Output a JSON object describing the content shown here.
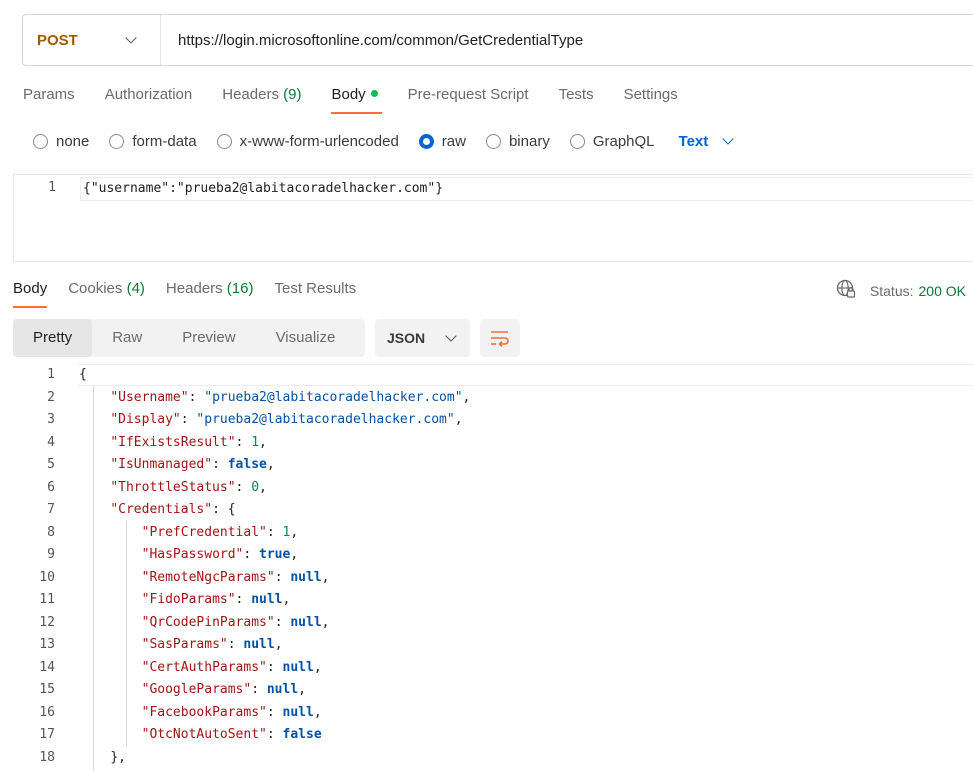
{
  "request": {
    "method": "POST",
    "url": "https://login.microsoftonline.com/common/GetCredentialType"
  },
  "request_tabs": [
    {
      "label": "Params",
      "count": ""
    },
    {
      "label": "Authorization",
      "count": ""
    },
    {
      "label": "Headers",
      "count": "(9)"
    },
    {
      "label": "Body",
      "count": ""
    },
    {
      "label": "Pre-request Script",
      "count": ""
    },
    {
      "label": "Tests",
      "count": ""
    },
    {
      "label": "Settings",
      "count": ""
    }
  ],
  "active_request_tab": "Body",
  "body_types": [
    "none",
    "form-data",
    "x-www-form-urlencoded",
    "raw",
    "binary",
    "GraphQL"
  ],
  "selected_body_type": "raw",
  "raw_format": "Text",
  "request_body": {
    "line_number": "1",
    "text": "{\"username\":\"prueba2@labitacoradelhacker.com\"}"
  },
  "response_tabs": [
    {
      "label": "Body",
      "count": ""
    },
    {
      "label": "Cookies",
      "count": "(4)"
    },
    {
      "label": "Headers",
      "count": "(16)"
    },
    {
      "label": "Test Results",
      "count": ""
    }
  ],
  "status": {
    "label": "Status:",
    "value": "200 OK"
  },
  "view_modes": [
    "Pretty",
    "Raw",
    "Preview",
    "Visualize"
  ],
  "active_view_mode": "Pretty",
  "response_format": "JSON",
  "icons": {
    "method_dropdown": "chevron-down-icon",
    "format_dropdown": "chevron-down-icon",
    "network": "globe-icon",
    "wrap": "wrap-lines-icon"
  },
  "colors": {
    "accent": "#ff6c37",
    "method": "#a35a00",
    "link": "#0265d2",
    "success": "#0a7a34"
  },
  "response_lines": [
    {
      "n": "1",
      "indent": 0,
      "tokens": [
        [
          "p",
          "{"
        ]
      ]
    },
    {
      "n": "2",
      "indent": 1,
      "tokens": [
        [
          "k",
          "\"Username\""
        ],
        [
          "p",
          ": "
        ],
        [
          "s",
          "\"prueba2@labitacoradelhacker.com\""
        ],
        [
          "p",
          ","
        ]
      ]
    },
    {
      "n": "3",
      "indent": 1,
      "tokens": [
        [
          "k",
          "\"Display\""
        ],
        [
          "p",
          ": "
        ],
        [
          "s",
          "\"prueba2@labitacoradelhacker.com\""
        ],
        [
          "p",
          ","
        ]
      ]
    },
    {
      "n": "4",
      "indent": 1,
      "tokens": [
        [
          "k",
          "\"IfExistsResult\""
        ],
        [
          "p",
          ": "
        ],
        [
          "num",
          "1"
        ],
        [
          "p",
          ","
        ]
      ]
    },
    {
      "n": "5",
      "indent": 1,
      "tokens": [
        [
          "k",
          "\"IsUnmanaged\""
        ],
        [
          "p",
          ": "
        ],
        [
          "b",
          "false"
        ],
        [
          "p",
          ","
        ]
      ]
    },
    {
      "n": "6",
      "indent": 1,
      "tokens": [
        [
          "k",
          "\"ThrottleStatus\""
        ],
        [
          "p",
          ": "
        ],
        [
          "num",
          "0"
        ],
        [
          "p",
          ","
        ]
      ]
    },
    {
      "n": "7",
      "indent": 1,
      "tokens": [
        [
          "k",
          "\"Credentials\""
        ],
        [
          "p",
          ": {"
        ]
      ]
    },
    {
      "n": "8",
      "indent": 2,
      "tokens": [
        [
          "k",
          "\"PrefCredential\""
        ],
        [
          "p",
          ": "
        ],
        [
          "num",
          "1"
        ],
        [
          "p",
          ","
        ]
      ]
    },
    {
      "n": "9",
      "indent": 2,
      "tokens": [
        [
          "k",
          "\"HasPassword\""
        ],
        [
          "p",
          ": "
        ],
        [
          "b",
          "true"
        ],
        [
          "p",
          ","
        ]
      ]
    },
    {
      "n": "10",
      "indent": 2,
      "tokens": [
        [
          "k",
          "\"RemoteNgcParams\""
        ],
        [
          "p",
          ": "
        ],
        [
          "b",
          "null"
        ],
        [
          "p",
          ","
        ]
      ]
    },
    {
      "n": "11",
      "indent": 2,
      "tokens": [
        [
          "k",
          "\"FidoParams\""
        ],
        [
          "p",
          ": "
        ],
        [
          "b",
          "null"
        ],
        [
          "p",
          ","
        ]
      ]
    },
    {
      "n": "12",
      "indent": 2,
      "tokens": [
        [
          "k",
          "\"QrCodePinParams\""
        ],
        [
          "p",
          ": "
        ],
        [
          "b",
          "null"
        ],
        [
          "p",
          ","
        ]
      ]
    },
    {
      "n": "13",
      "indent": 2,
      "tokens": [
        [
          "k",
          "\"SasParams\""
        ],
        [
          "p",
          ": "
        ],
        [
          "b",
          "null"
        ],
        [
          "p",
          ","
        ]
      ]
    },
    {
      "n": "14",
      "indent": 2,
      "tokens": [
        [
          "k",
          "\"CertAuthParams\""
        ],
        [
          "p",
          ": "
        ],
        [
          "b",
          "null"
        ],
        [
          "p",
          ","
        ]
      ]
    },
    {
      "n": "15",
      "indent": 2,
      "tokens": [
        [
          "k",
          "\"GoogleParams\""
        ],
        [
          "p",
          ": "
        ],
        [
          "b",
          "null"
        ],
        [
          "p",
          ","
        ]
      ]
    },
    {
      "n": "16",
      "indent": 2,
      "tokens": [
        [
          "k",
          "\"FacebookParams\""
        ],
        [
          "p",
          ": "
        ],
        [
          "b",
          "null"
        ],
        [
          "p",
          ","
        ]
      ]
    },
    {
      "n": "17",
      "indent": 2,
      "tokens": [
        [
          "k",
          "\"OtcNotAutoSent\""
        ],
        [
          "p",
          ": "
        ],
        [
          "b",
          "false"
        ]
      ]
    },
    {
      "n": "18",
      "indent": 1,
      "tokens": [
        [
          "p",
          "},"
        ]
      ]
    }
  ]
}
